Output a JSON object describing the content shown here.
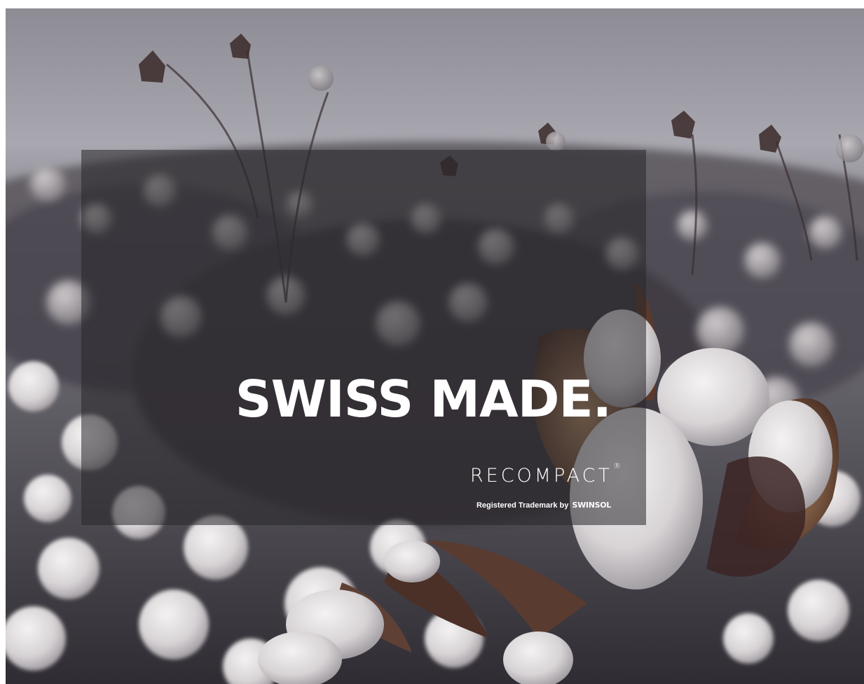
{
  "hero": {
    "headline": "SWISS MADE.",
    "brand_name": "RECOMPACT",
    "brand_registered_mark": "®",
    "trademark_prefix": "Registered Trademark by",
    "trademark_owner": "SWINSOL"
  },
  "photo": {
    "subject": "cotton-field-photo",
    "overlay_color": "#28262a",
    "text_color": "#ffffff"
  }
}
